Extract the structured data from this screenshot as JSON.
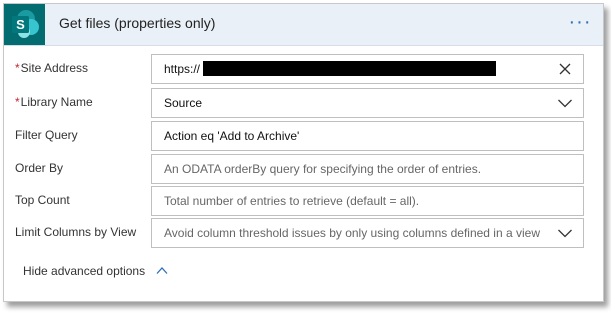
{
  "header": {
    "app_icon": "sharepoint-icon",
    "app_letter": "S",
    "title": "Get files (properties only)",
    "more_icon": "ellipsis-icon",
    "more_text": "···",
    "accent_color": "#036c70",
    "header_bg": "#e9f0f8"
  },
  "fields": {
    "site_address": {
      "label": "Site Address",
      "required": "*",
      "value": "https://",
      "icon": "clear-x-icon"
    },
    "library_name": {
      "label": "Library Name",
      "required": "*",
      "value": "Source",
      "icon": "chevron-down-icon"
    },
    "filter_query": {
      "label": "Filter Query",
      "value": "Action eq 'Add to Archive'"
    },
    "order_by": {
      "label": "Order By",
      "placeholder": "An ODATA orderBy query for specifying the order of entries."
    },
    "top_count": {
      "label": "Top Count",
      "placeholder": "Total number of entries to retrieve (default = all)."
    },
    "limit_columns": {
      "label": "Limit Columns by View",
      "placeholder": "Avoid column threshold issues by only using columns defined in a view",
      "icon": "chevron-down-icon"
    }
  },
  "footer": {
    "advanced_label": "Hide advanced options",
    "advanced_icon": "chevron-up-icon",
    "link_color": "#2f6fb4"
  }
}
